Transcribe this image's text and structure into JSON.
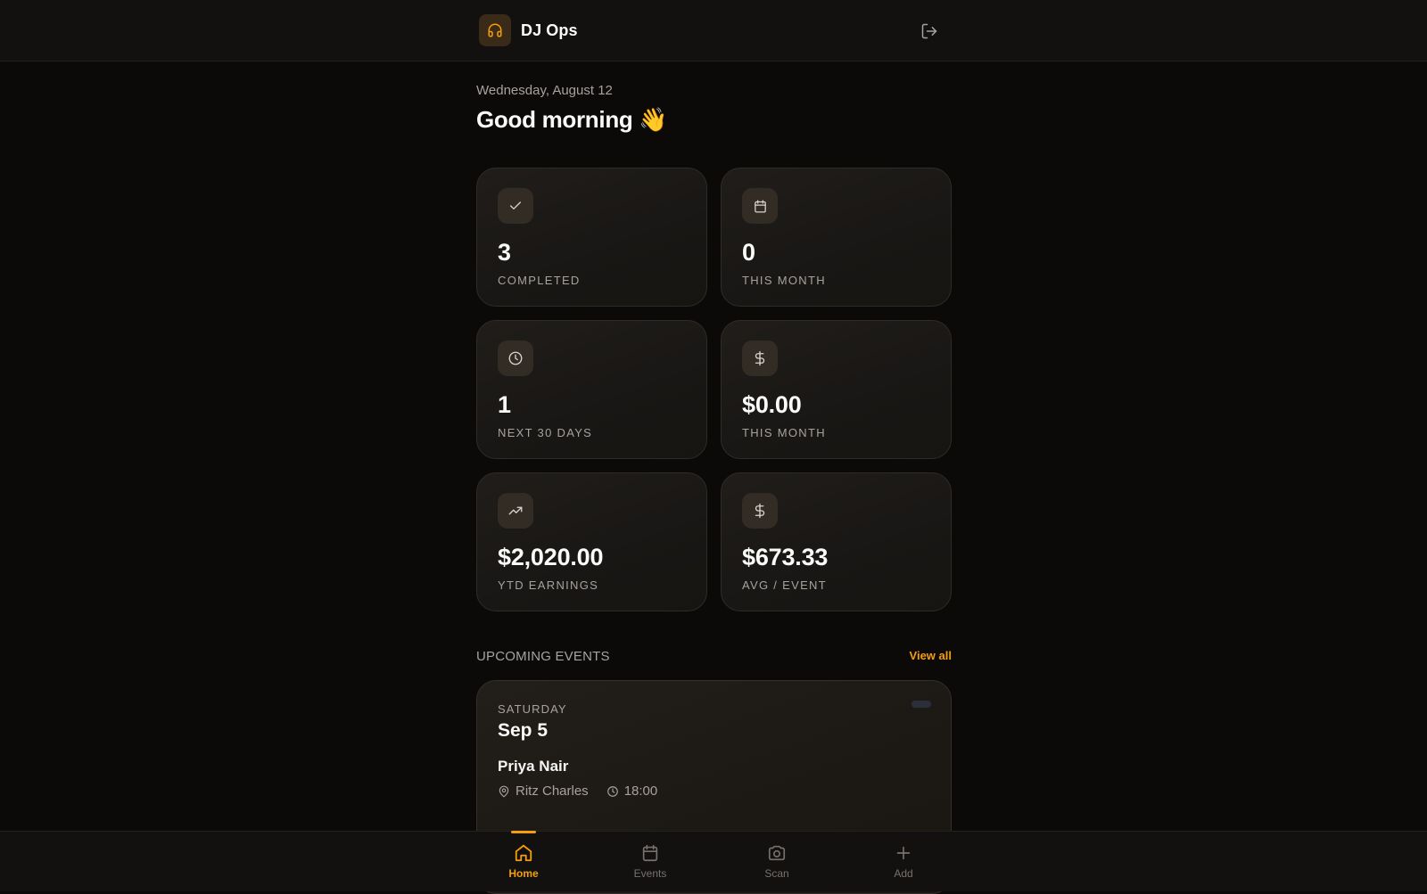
{
  "app": {
    "name": "DJ Ops",
    "logo_icon": "headphones-icon",
    "accent": "#f59e0b"
  },
  "header": {
    "logout_icon": "logout-icon"
  },
  "greeting": {
    "date": "Wednesday, August 12",
    "text": "Good morning 👋"
  },
  "stats": [
    {
      "icon": "check-icon",
      "value": "3",
      "label": "COMPLETED"
    },
    {
      "icon": "calendar-icon",
      "value": "0",
      "label": "THIS MONTH"
    },
    {
      "icon": "clock-icon",
      "value": "1",
      "label": "NEXT 30 DAYS"
    },
    {
      "icon": "dollar-icon",
      "value": "$0.00",
      "label": "THIS MONTH"
    },
    {
      "icon": "trending-up-icon",
      "value": "$2,020.00",
      "label": "YTD EARNINGS"
    },
    {
      "icon": "dollar-icon",
      "value": "$673.33",
      "label": "AVG / EVENT"
    }
  ],
  "upcoming": {
    "title": "UPCOMING EVENTS",
    "view_all": "View all",
    "events": [
      {
        "day": "SATURDAY",
        "date": "Sep 5",
        "client": "Priya Nair",
        "venue": "Ritz Charles",
        "time": "18:00"
      }
    ]
  },
  "nav": {
    "items": [
      {
        "label": "Home",
        "icon": "home-icon",
        "active": true
      },
      {
        "label": "Events",
        "icon": "calendar-icon",
        "active": false
      },
      {
        "label": "Scan",
        "icon": "camera-icon",
        "active": false
      },
      {
        "label": "Add",
        "icon": "plus-icon",
        "active": false
      }
    ]
  }
}
